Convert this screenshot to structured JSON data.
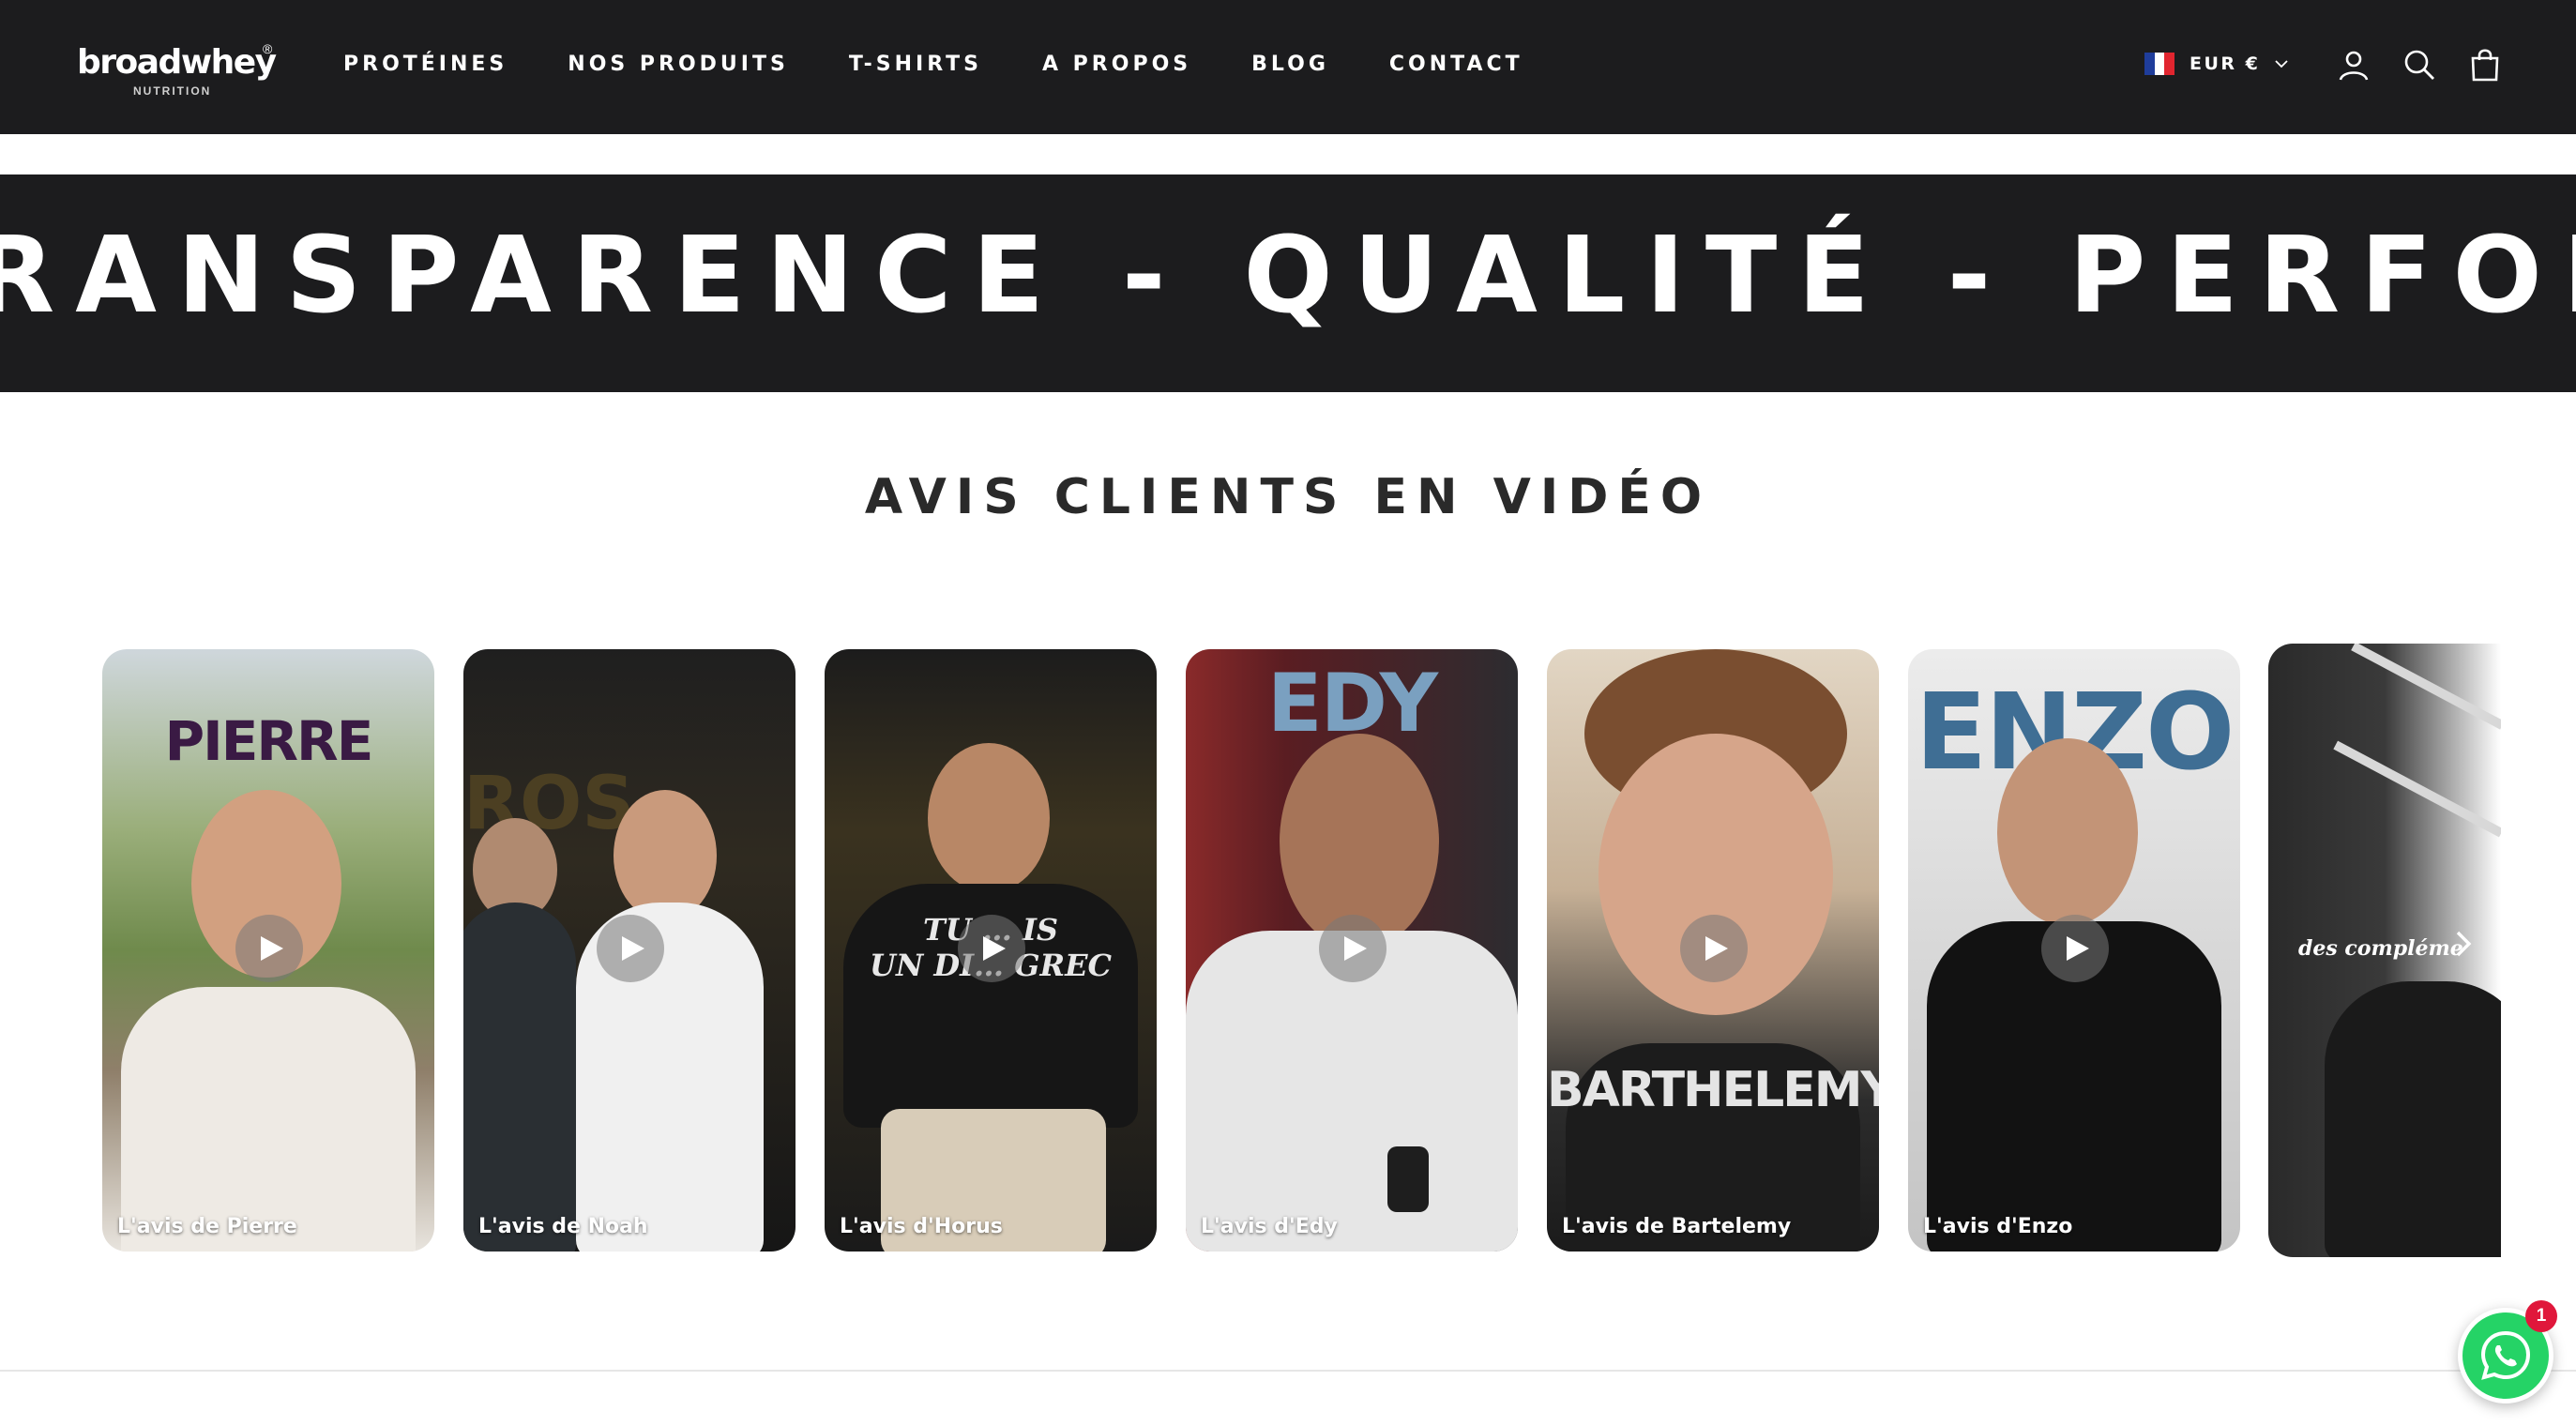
{
  "header": {
    "logo": {
      "main": "broadwhey",
      "reg": "®",
      "sub": "NUTRITION"
    },
    "nav": [
      "PROTÉINES",
      "NOS PRODUITS",
      "T-SHIRTS",
      "A PROPOS",
      "BLOG",
      "CONTACT"
    ],
    "locale": {
      "currency": "EUR €",
      "flag_colors": [
        "#1f3d9b",
        "#ffffff",
        "#e1252f"
      ]
    },
    "icons": [
      "account-icon",
      "search-icon",
      "cart-icon"
    ]
  },
  "marquee": {
    "text": "RANSPARENCE -   QUALITÉ - PERFORMANCE"
  },
  "section": {
    "title": "AVIS CLIENTS EN VIDÉO"
  },
  "videos": [
    {
      "overlay": "PIERRE",
      "caption": "L'avis de Pierre"
    },
    {
      "overlay": "",
      "caption": "L'avis de Noah"
    },
    {
      "overlay": "TU … IS\nUN DI… GREC",
      "caption": "L'avis d'Horus"
    },
    {
      "overlay": "EDY",
      "caption": "L'avis d'Edy"
    },
    {
      "overlay": "BARTHELEMY",
      "caption": "L'avis de Bartelemy"
    },
    {
      "overlay": "ENZO",
      "caption": "L'avis d'Enzo"
    },
    {
      "overlay": "des compléme",
      "caption": ""
    }
  ],
  "whatsapp": {
    "badge": "1",
    "color": "#25d366"
  }
}
